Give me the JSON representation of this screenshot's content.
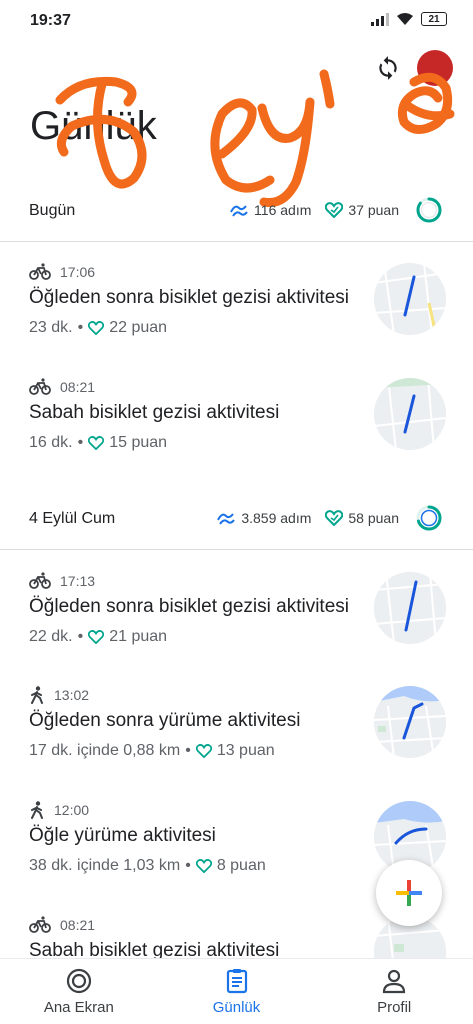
{
  "status_bar": {
    "time": "19:37",
    "battery": "21"
  },
  "header": {
    "title": "Günlük"
  },
  "days": [
    {
      "label": "Bugün",
      "steps": "116 adım",
      "points": "37 puan",
      "ring_progress": 0.85,
      "activities": [
        {
          "type": "bike-icon",
          "time": "17:06",
          "title": "Öğleden sonra bisiklet gezisi aktivitesi",
          "detail": "23 dk.",
          "points": "22 puan"
        },
        {
          "type": "bike-icon",
          "time": "08:21",
          "title": "Sabah bisiklet gezisi aktivitesi",
          "detail": "16 dk.",
          "points": "15 puan"
        }
      ]
    },
    {
      "label": "4 Eylül Cum",
      "steps": "3.859 adım",
      "points": "58 puan",
      "ring_progress": 0.7,
      "activities": [
        {
          "type": "bike-icon",
          "time": "17:13",
          "title": "Öğleden sonra bisiklet gezisi aktivitesi",
          "detail": "22 dk.",
          "points": "21 puan"
        },
        {
          "type": "walk-icon",
          "time": "13:02",
          "title": "Öğleden sonra yürüme aktivitesi",
          "detail": "17 dk. içinde 0,88 km",
          "points": "13 puan"
        },
        {
          "type": "walk-icon",
          "time": "12:00",
          "title": "Öğle yürüme aktivitesi",
          "detail": "38 dk. içinde 1,03 km",
          "points": "8 puan"
        },
        {
          "type": "bike-icon",
          "time": "08:21",
          "title": "Sabah bisiklet gezisi aktivitesi",
          "detail": "",
          "points": ""
        }
      ]
    }
  ],
  "bottom_nav": [
    {
      "label": "Ana Ekran",
      "icon": "home-ring-icon",
      "active": false
    },
    {
      "label": "Günlük",
      "icon": "journal-icon",
      "active": true
    },
    {
      "label": "Profil",
      "icon": "person-icon",
      "active": false
    }
  ],
  "colors": {
    "accent": "#1a73e8",
    "heart": "#00a58e",
    "steps": "#1a73e8",
    "scribble": "#f26a1b"
  }
}
